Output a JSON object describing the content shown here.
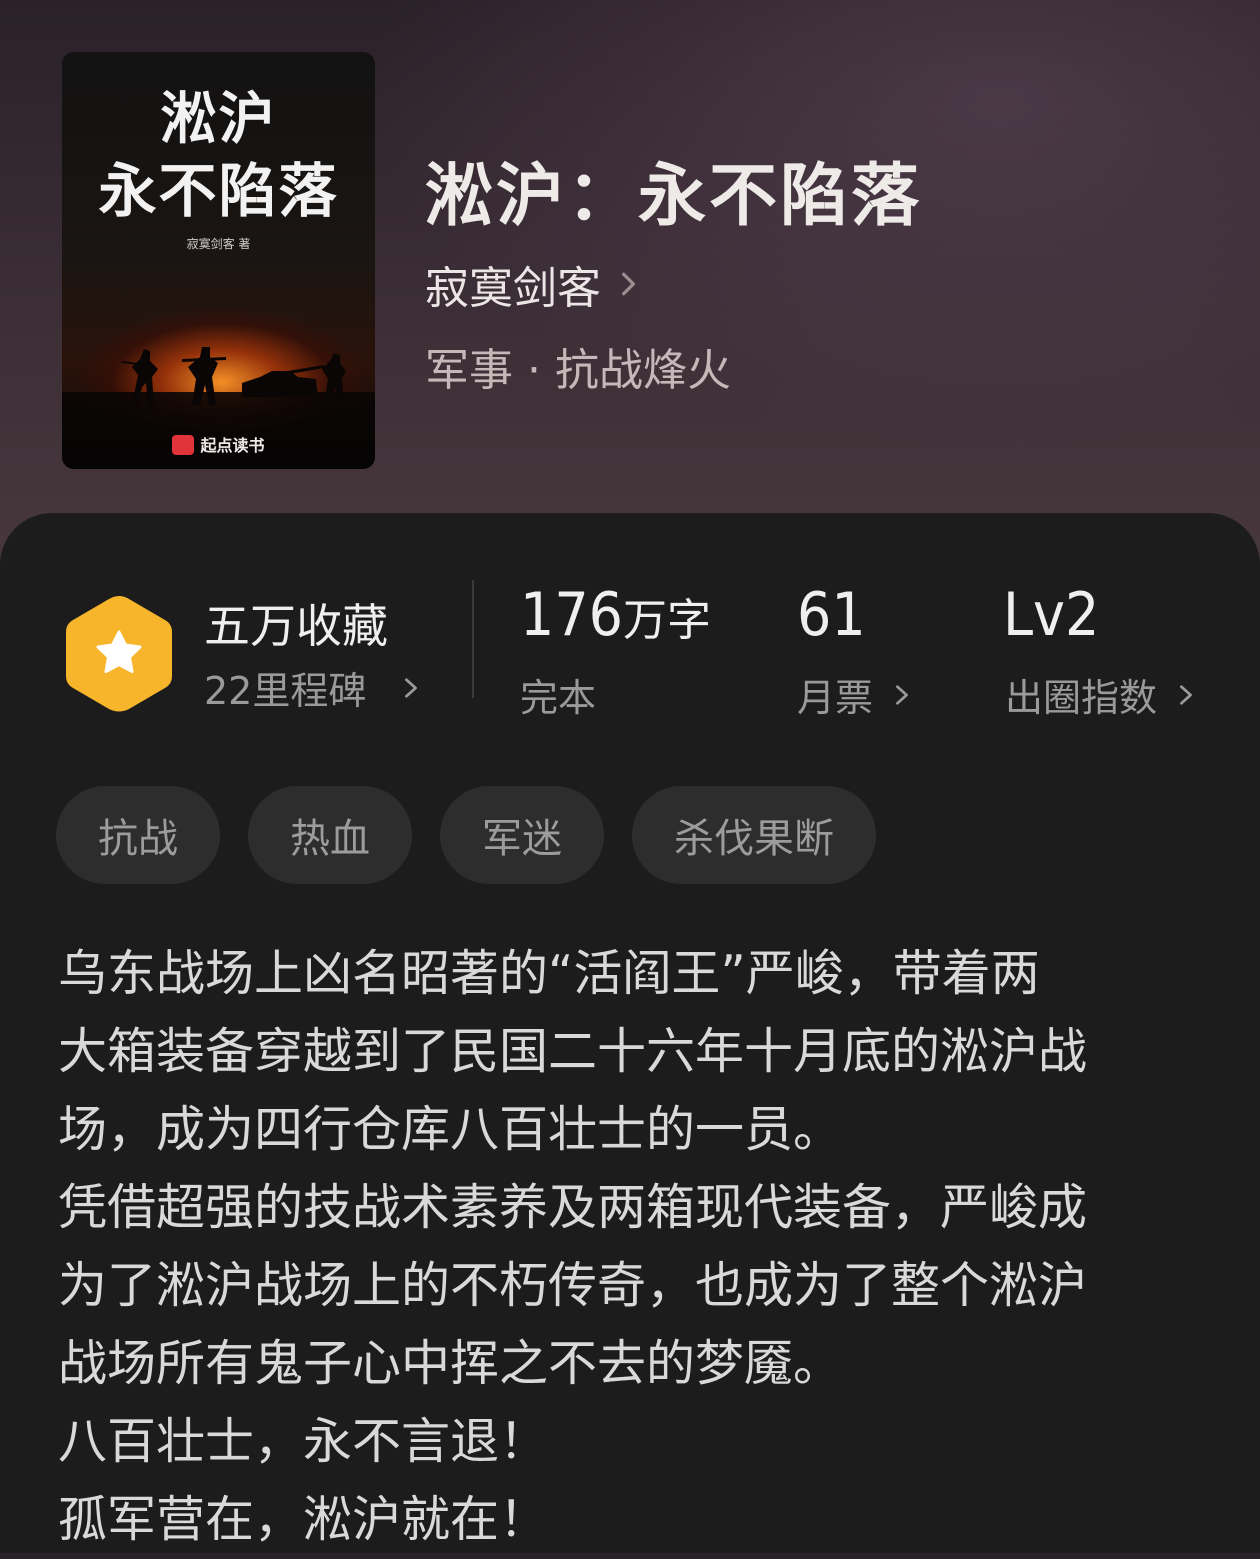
{
  "book": {
    "cover": {
      "title_line1": "淞沪",
      "title_line2": "永不陷落",
      "author_small": "寂寞剑客 著",
      "publisher": "起点读书"
    },
    "title": "淞沪：永不陷落",
    "author": "寂寞剑客",
    "genre": "军事 · 抗战烽火"
  },
  "stats": {
    "favorites": {
      "value": "五万收藏",
      "sub": "22里程碑"
    },
    "words": {
      "number": "176",
      "unit": "万字",
      "sub": "完本"
    },
    "monthly_votes": {
      "number": "61",
      "sub": "月票"
    },
    "popularity": {
      "number": "Lv2",
      "sub": "出圈指数"
    }
  },
  "tags": [
    "抗战",
    "热血",
    "军迷",
    "杀伐果断"
  ],
  "synopsis": [
    "乌东战场上凶名昭著的“活阎王”严峻，带着两",
    "大箱装备穿越到了民国二十六年十月底的淞沪战",
    "场，成为四行仓库八百壮士的一员。",
    "凭借超强的技战术素养及两箱现代装备，严峻成",
    "为了淞沪战场上的不朽传奇，也成为了整个淞沪",
    "战场所有鬼子心中挥之不去的梦魇。",
    "八百壮士，永不言退！",
    "孤军营在，淞沪就在！"
  ],
  "icons": {
    "badge": "star-hexagon-icon",
    "chevron": "chevron-right-icon"
  },
  "colors": {
    "badge": "#f7b52b",
    "panel": "#1c1c1c",
    "tag_bg": "#2d2d2d"
  }
}
